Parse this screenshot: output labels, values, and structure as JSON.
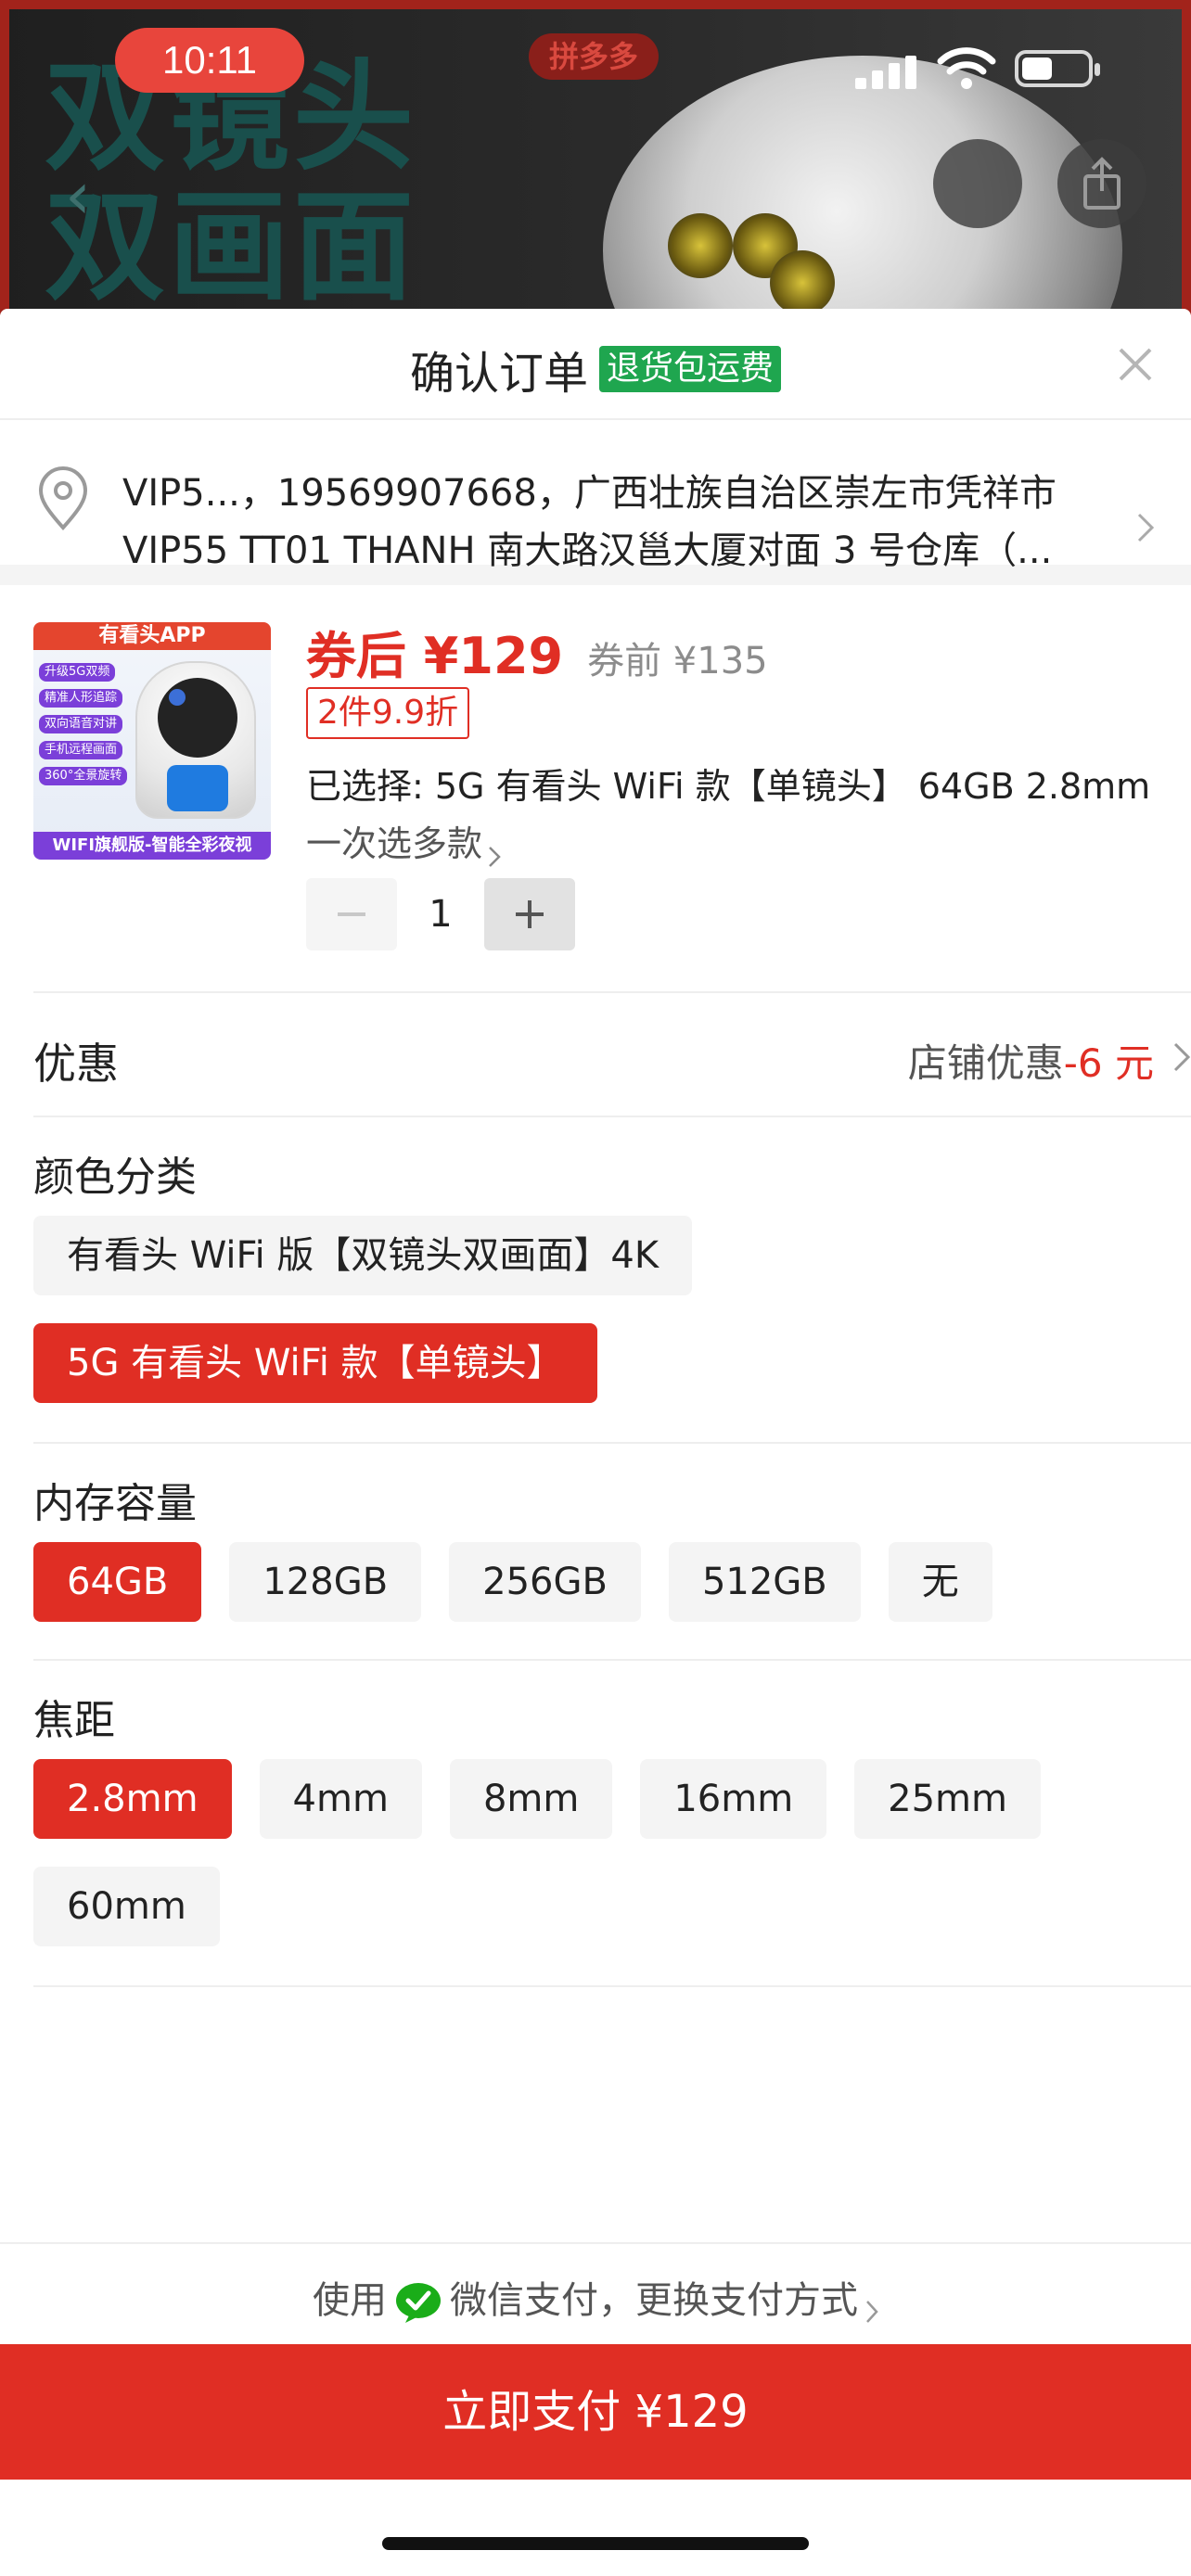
{
  "status_bar": {
    "time": "10:11"
  },
  "background": {
    "headline_line1": "双镜头",
    "headline_line2": "双画面",
    "logo_text": "拼多多"
  },
  "sheet": {
    "title": "确认订单",
    "badge": "退货包运费"
  },
  "address": {
    "line1": "VIP5...，19569907668，广西壮族自治区崇左市凭祥市",
    "line2": "VIP55 TT01 THANH 南大路汉邕大厦对面 3 号仓库（..."
  },
  "product": {
    "thumbnail": {
      "top_text": "有看头APP",
      "tags": [
        "升级5G双频",
        "精准人形追踪",
        "双向语音对讲",
        "手机远程画面",
        "360°全景旋转"
      ],
      "bottom_text": "WIFI旗舰版-智能全彩夜视"
    },
    "price_after_label": "券后 ¥129",
    "price_before_label": "券前 ¥135",
    "promo_tag": "2件9.9折",
    "selected_label": "已选择: 5G 有看头 WiFi 款【单镜头】 64GB 2.8mm",
    "multi_select_link": "一次选多款",
    "quantity": "1"
  },
  "discount": {
    "label": "优惠",
    "value_prefix": "店铺优惠",
    "value_amount": "-6 元"
  },
  "options": {
    "color": {
      "title": "颜色分类",
      "items": [
        "有看头 WiFi 版【双镜头双画面】4K",
        "5G 有看头 WiFi 款【单镜头】"
      ],
      "selected": "5G 有看头 WiFi 款【单镜头】"
    },
    "memory": {
      "title": "内存容量",
      "items": [
        "64GB",
        "128GB",
        "256GB",
        "512GB",
        "无"
      ],
      "selected": "64GB"
    },
    "focal": {
      "title": "焦距",
      "items": [
        "2.8mm",
        "4mm",
        "8mm",
        "16mm",
        "25mm",
        "60mm"
      ],
      "selected": "2.8mm"
    }
  },
  "payment": {
    "prefix": "使用",
    "method": "微信支付，更换支付方式",
    "pay_button": "立即支付 ¥129"
  },
  "colors": {
    "accent_red": "#e02e24",
    "badge_green": "#1fa64f",
    "wechat_green": "#1aad19"
  },
  "icons": [
    "location-pin-icon",
    "close-icon",
    "chevron-right-icon",
    "minus-icon",
    "plus-icon",
    "wechat-pay-icon",
    "back-arrow-icon",
    "share-icon"
  ]
}
